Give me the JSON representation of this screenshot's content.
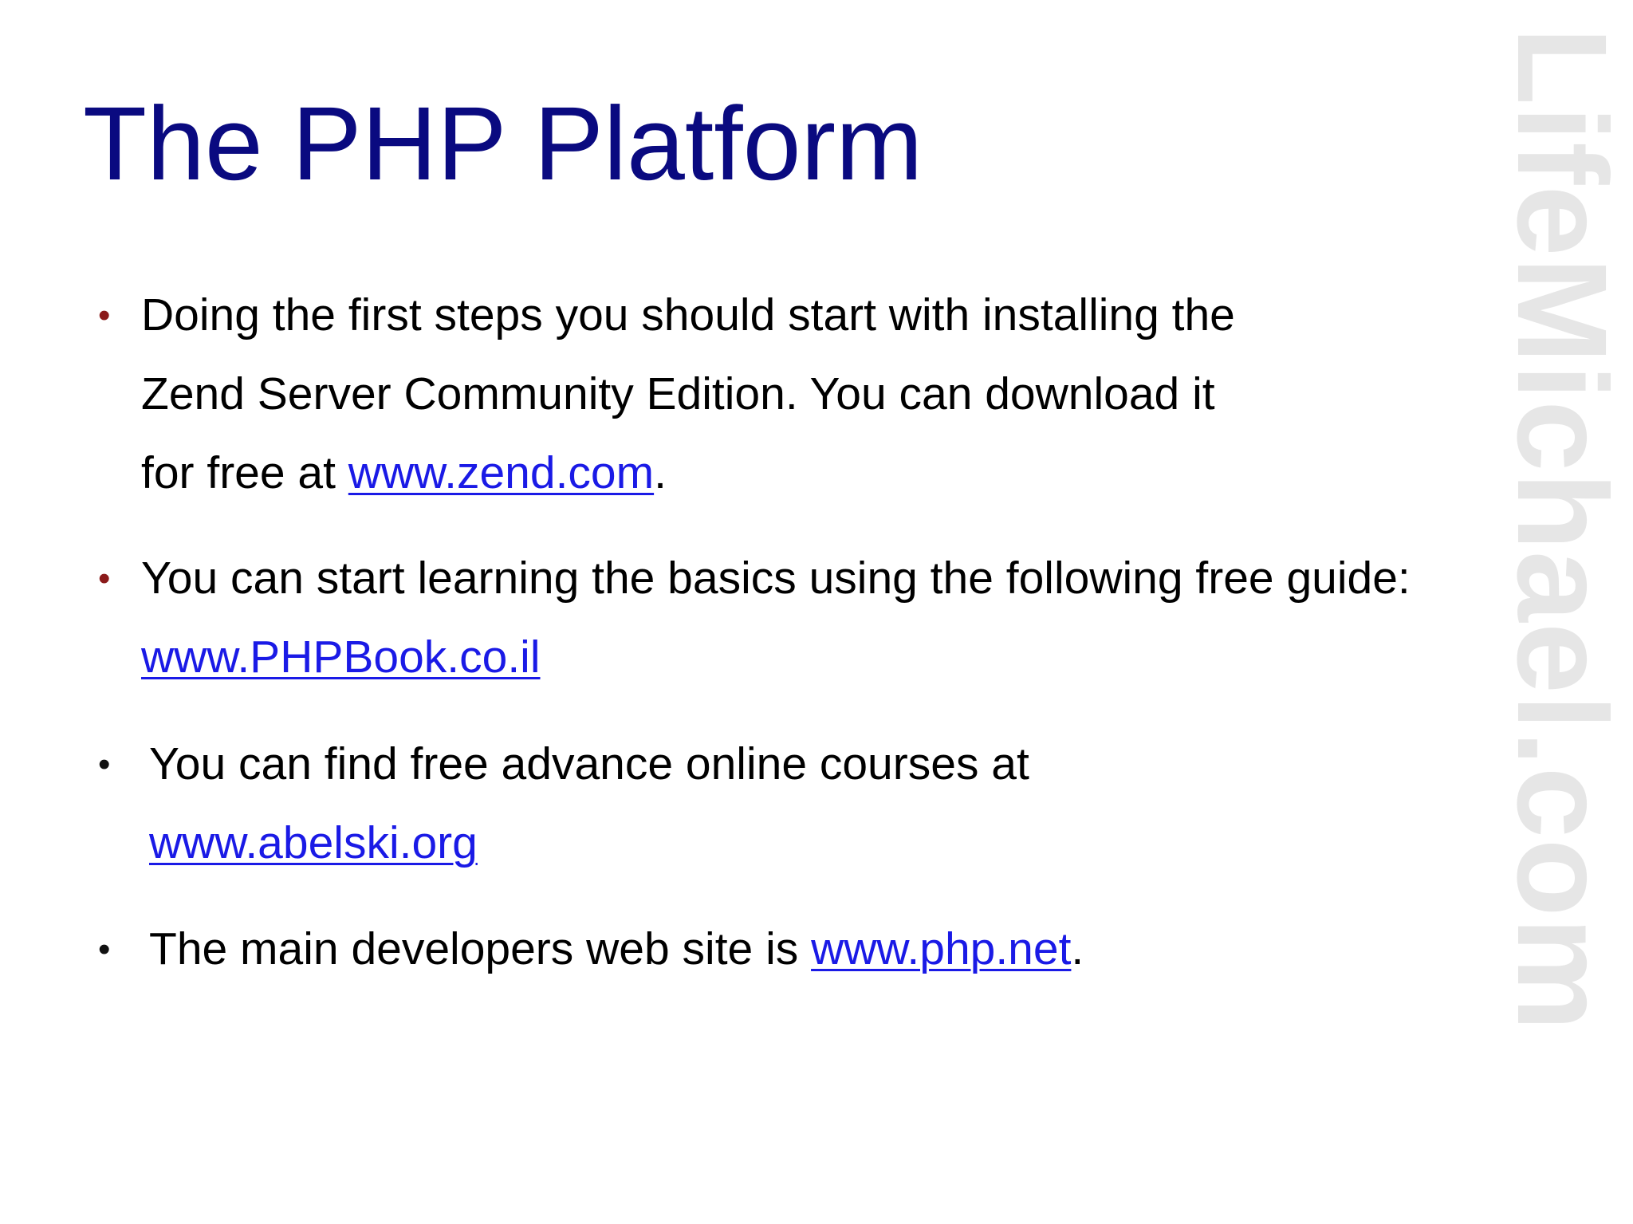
{
  "slide": {
    "title": "The PHP Platform",
    "watermark": "LifeMichael.com",
    "bullets": [
      {
        "line1": "Doing the first steps you should start with installing the",
        "line2": "Zend Server Community Edition. You can download it",
        "line3_prefix": "for free at ",
        "line3_link": "www.zend.com",
        "line3_suffix": "."
      },
      {
        "line1": "You can start learning the basics using the following free guide:",
        "line2_link": "www.PHPBook.co.il"
      },
      {
        "line1": "You can find free advance online courses at",
        "line2_link": "www.abelski.org"
      },
      {
        "line1_prefix": "The main developers web site is ",
        "line1_link": "www.php.net",
        "line1_suffix": "."
      }
    ],
    "bullet_symbol": "•"
  },
  "colors": {
    "title": "#0a0a80",
    "link": "#1a1ae6",
    "bullet_red": "#8b1a1a",
    "watermark": "#e6e6e6"
  }
}
